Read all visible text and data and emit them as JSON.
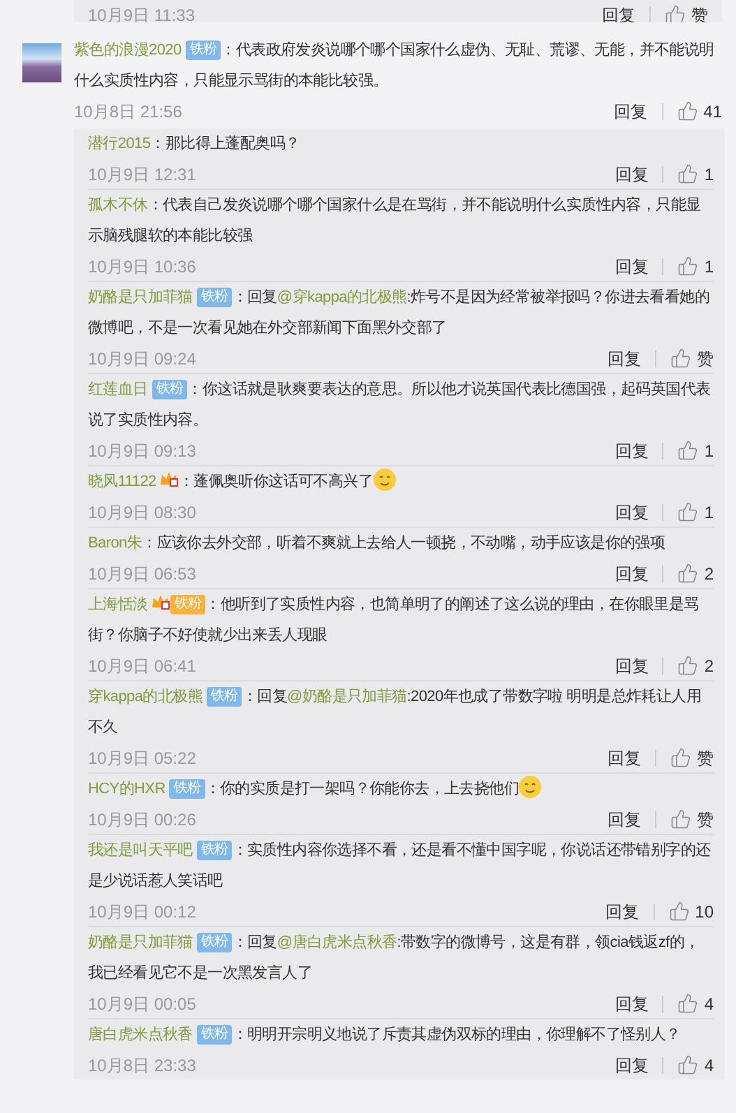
{
  "top_reply": {
    "time": "10月9日 11:33",
    "reply_label": "回复",
    "likes": "赞"
  },
  "comment": {
    "user": "紫色的浪漫2020",
    "badge": {
      "kind": "fan",
      "text": "铁粉"
    },
    "parts": [
      {
        "kind": "plain",
        "text": "：代表政府发炎说哪个哪个国家什么虚伪、无耻、荒谬、无能，并不能说明什么实质性内容，只能显示骂街的本能比较强。"
      }
    ],
    "time": "10月8日 21:56",
    "reply_label": "回复",
    "likes": "41"
  },
  "replies": [
    {
      "user": "潜行2015",
      "parts": [
        {
          "kind": "plain",
          "text": "：那比得上蓬配奥吗？"
        }
      ],
      "time": "10月9日 12:31",
      "reply_label": "回复",
      "likes": "1"
    },
    {
      "user": "孤木不休",
      "parts": [
        {
          "kind": "plain",
          "text": "：代表自己发炎说哪个哪个国家什么是在骂街，并不能说明什么实质性内容，只能显示脑残腿软的本能比较强"
        }
      ],
      "time": "10月9日 10:36",
      "reply_label": "回复",
      "likes": "1"
    },
    {
      "user": "奶酪是只加菲猫",
      "badge": {
        "kind": "fan",
        "text": "铁粉"
      },
      "parts": [
        {
          "kind": "plain",
          "text": "：回复"
        },
        {
          "kind": "mention",
          "text": "@穿kappa的北极熊"
        },
        {
          "kind": "plain",
          "text": ":炸号不是因为经常被举报吗？你进去看看她的微博吧，不是一次看见她在外交部新闻下面黑外交部了"
        }
      ],
      "time": "10月9日 09:24",
      "reply_label": "回复",
      "likes": "赞"
    },
    {
      "user": "红莲血日",
      "badge": {
        "kind": "fan",
        "text": "铁粉"
      },
      "parts": [
        {
          "kind": "plain",
          "text": "：你这话就是耿爽要表达的意思。所以他才说英国代表比德国强，起码英国代表说了实质性内容。"
        }
      ],
      "time": "10月9日 09:13",
      "reply_label": "回复",
      "likes": "1"
    },
    {
      "user": "晓风11122",
      "badge": {
        "kind": "crown"
      },
      "parts": [
        {
          "kind": "plain",
          "text": "：蓬佩奥听你这话可不高兴了"
        },
        {
          "kind": "emoji"
        }
      ],
      "time": "10月9日 08:30",
      "reply_label": "回复",
      "likes": "1"
    },
    {
      "user": "Baron朱",
      "parts": [
        {
          "kind": "plain",
          "text": "：应该你去外交部，听着不爽就上去给人一顿挠，不动嘴，动手应该是你的强项"
        }
      ],
      "time": "10月9日 06:53",
      "reply_label": "回复",
      "likes": "2"
    },
    {
      "user": "上海恬淡",
      "badge": {
        "kind": "crown_fan",
        "text": "铁粉"
      },
      "parts": [
        {
          "kind": "plain",
          "text": "：他听到了实质性内容，也简单明了的阐述了这么说的理由，在你眼里是骂街？你脑子不好使就少出来丢人现眼"
        }
      ],
      "time": "10月9日 06:41",
      "reply_label": "回复",
      "likes": "2"
    },
    {
      "user": "穿kappa的北极熊",
      "badge": {
        "kind": "fan",
        "text": "铁粉"
      },
      "parts": [
        {
          "kind": "plain",
          "text": "：回复"
        },
        {
          "kind": "mention",
          "text": "@奶酪是只加菲猫"
        },
        {
          "kind": "plain",
          "text": ":2020年也成了带数字啦 明明是总炸耗让人用不久"
        }
      ],
      "time": "10月9日 05:22",
      "reply_label": "回复",
      "likes": "赞"
    },
    {
      "user": "HCY的HXR",
      "badge": {
        "kind": "fan",
        "text": "铁粉"
      },
      "parts": [
        {
          "kind": "plain",
          "text": "：你的实质是打一架吗？你能你去，上去挠他们"
        },
        {
          "kind": "emoji"
        }
      ],
      "time": "10月9日 00:26",
      "reply_label": "回复",
      "likes": "赞"
    },
    {
      "user": "我还是叫天平吧",
      "badge": {
        "kind": "fan",
        "text": "铁粉"
      },
      "parts": [
        {
          "kind": "plain",
          "text": "：实质性内容你选择不看，还是看不懂中国字呢，你说话还带错别字的还是少说话惹人笑话吧"
        }
      ],
      "time": "10月9日 00:12",
      "reply_label": "回复",
      "likes": "10"
    },
    {
      "user": "奶酪是只加菲猫",
      "badge": {
        "kind": "fan",
        "text": "铁粉"
      },
      "parts": [
        {
          "kind": "plain",
          "text": "：回复"
        },
        {
          "kind": "mention",
          "text": "@唐白虎米点秋香"
        },
        {
          "kind": "plain",
          "text": ":带数字的微博号，这是有群，领cia钱返zf的，我已经看见它不是一次黑发言人了"
        }
      ],
      "time": "10月9日 00:05",
      "reply_label": "回复",
      "likes": "4"
    },
    {
      "user": "唐白虎米点秋香",
      "badge": {
        "kind": "fan",
        "text": "铁粉"
      },
      "parts": [
        {
          "kind": "plain",
          "text": "：明明开宗明义地说了斥责其虚伪双标的理由，你理解不了怪别人？"
        }
      ],
      "time": "10月8日 23:33",
      "reply_label": "回复",
      "likes": "4"
    }
  ]
}
